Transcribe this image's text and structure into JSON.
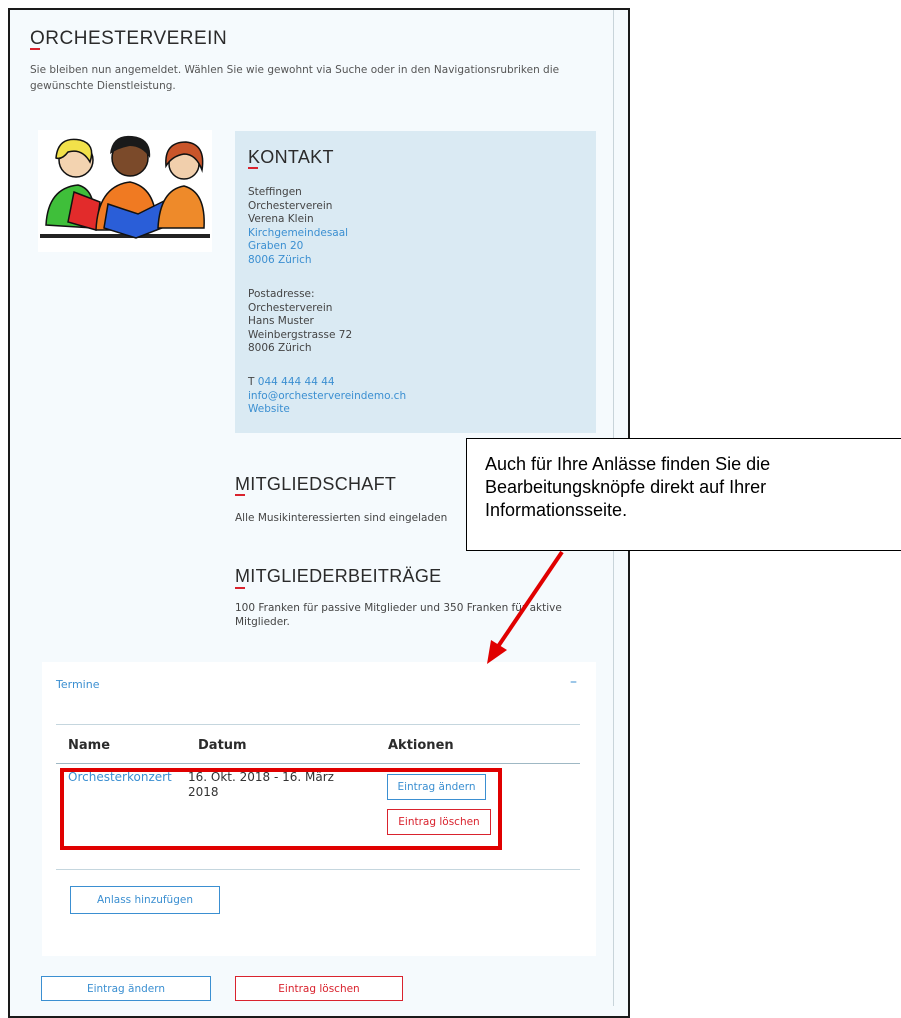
{
  "page": {
    "title": "ORCHESTERVEREIN",
    "intro": "Sie bleiben nun angemeldet. Wählen Sie wie gewohnt via Suche oder in den Navigationsrubriken die gewünschte Dienstleistung."
  },
  "contact": {
    "title": "KONTAKT",
    "lines": [
      "Steffingen",
      "Orchesterverein",
      "Verena Klein"
    ],
    "address_links": [
      "Kirchgemeindesaal",
      "Graben 20",
      "8006 Zürich"
    ],
    "postal_lines": [
      "Postadresse:",
      "Orchesterverein",
      "Hans Muster",
      "Weinbergstrasse 72",
      "8006 Zürich"
    ],
    "phone_prefix": "T",
    "phone": "044 444 44 44",
    "email": "info@orchestervereindemo.ch",
    "website": "Website"
  },
  "membership": {
    "title": "MITGLIEDSCHAFT",
    "text": "Alle Musikinteressierten sind eingeladen"
  },
  "fees": {
    "title": "MITGLIEDERBEITRÄGE",
    "text": "100 Franken für passive Mitglieder und 350 Franken für aktive Mitglieder."
  },
  "termine": {
    "label": "Termine",
    "collapse_symbol": "–",
    "columns": [
      "Name",
      "Datum",
      "Aktionen"
    ],
    "rows": [
      {
        "name": "Orchesterkonzert",
        "date": "16. Okt. 2018 - 16. März 2018",
        "edit_label": "Eintrag ändern",
        "delete_label": "Eintrag löschen"
      }
    ],
    "add_label": "Anlass hinzufügen"
  },
  "footer_actions": {
    "edit_label": "Eintrag ändern",
    "delete_label": "Eintrag löschen"
  },
  "callout": {
    "text": "Auch für Ihre Anlässe finden Sie die Bearbeitungsknöpfe direkt auf Ihrer Informationsseite."
  },
  "colors": {
    "accent_blue": "#3b8fd1",
    "accent_red": "#d9232e",
    "highlight_red": "#e00000",
    "contact_bg": "#daeaf3"
  },
  "icons": {
    "illustration": "children-reading-clipart",
    "collapse": "minus-icon",
    "arrow": "red-arrow"
  }
}
